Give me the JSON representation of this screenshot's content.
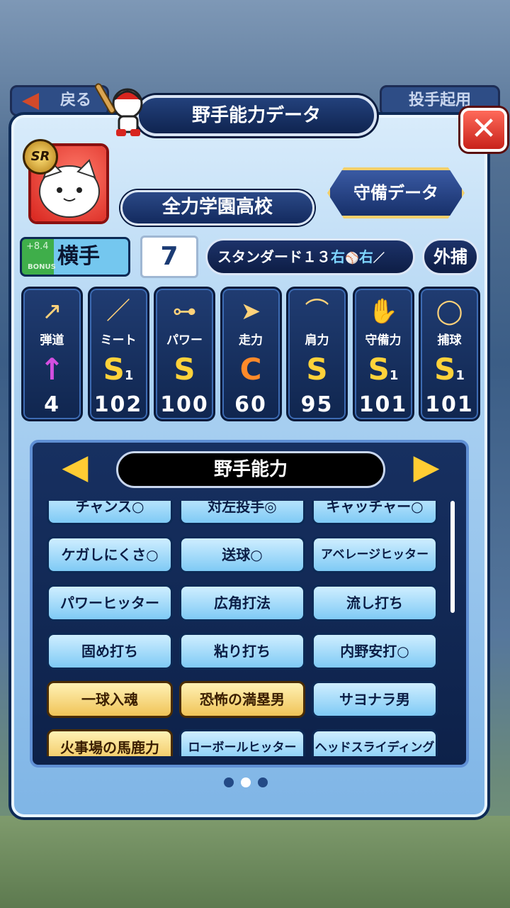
{
  "background": {
    "back_label": "戻る",
    "pitch_label": "投手起用"
  },
  "dialog": {
    "title": "野手能力データ",
    "close_symbol": "✕"
  },
  "player": {
    "rarity": "SR",
    "school": "全力学園高校",
    "defense_button": "守備データ",
    "position": "横手",
    "position_small": "+8.4",
    "position_bonus": "BONUS",
    "number": "7",
    "form_prefix": "スタンダード１３",
    "throws": "右",
    "bats": "右",
    "sub_position": "外捕"
  },
  "stats": [
    {
      "label": "弾道",
      "icon": "arrow-bat-icon",
      "grade": "↑",
      "value": "4"
    },
    {
      "label": "ミート",
      "icon": "bat-icon",
      "grade": "S1",
      "value": "102"
    },
    {
      "label": "パワー",
      "icon": "dumbbell-icon",
      "grade": "S",
      "value": "100"
    },
    {
      "label": "走力",
      "icon": "runner-icon",
      "grade": "C",
      "value": "60"
    },
    {
      "label": "肩力",
      "icon": "throw-arc-icon",
      "grade": "S",
      "value": "95"
    },
    {
      "label": "守備力",
      "icon": "glove-icon",
      "grade": "S1",
      "value": "101"
    },
    {
      "label": "捕球",
      "icon": "catch-ball-icon",
      "grade": "S1",
      "value": "101"
    }
  ],
  "abilities": {
    "title": "野手能力",
    "items": [
      {
        "label": "チャンス○",
        "gold": false
      },
      {
        "label": "対左投手◎",
        "gold": false
      },
      {
        "label": "キャッチャー○",
        "gold": false
      },
      {
        "label": "ケガしにくさ○",
        "gold": false
      },
      {
        "label": "送球○",
        "gold": false
      },
      {
        "label": "アベレージヒッター",
        "gold": false
      },
      {
        "label": "パワーヒッター",
        "gold": false
      },
      {
        "label": "広角打法",
        "gold": false
      },
      {
        "label": "流し打ち",
        "gold": false
      },
      {
        "label": "固め打ち",
        "gold": false
      },
      {
        "label": "粘り打ち",
        "gold": false
      },
      {
        "label": "内野安打○",
        "gold": false
      },
      {
        "label": "一球入魂",
        "gold": true
      },
      {
        "label": "恐怖の満塁男",
        "gold": true
      },
      {
        "label": "サヨナラ男",
        "gold": false
      },
      {
        "label": "火事場の馬鹿力",
        "gold": true
      },
      {
        "label": "ローボールヒッター",
        "gold": false
      },
      {
        "label": "ヘッドスライディング",
        "gold": false
      }
    ]
  },
  "pagination": {
    "pages": 3,
    "current": 2
  }
}
